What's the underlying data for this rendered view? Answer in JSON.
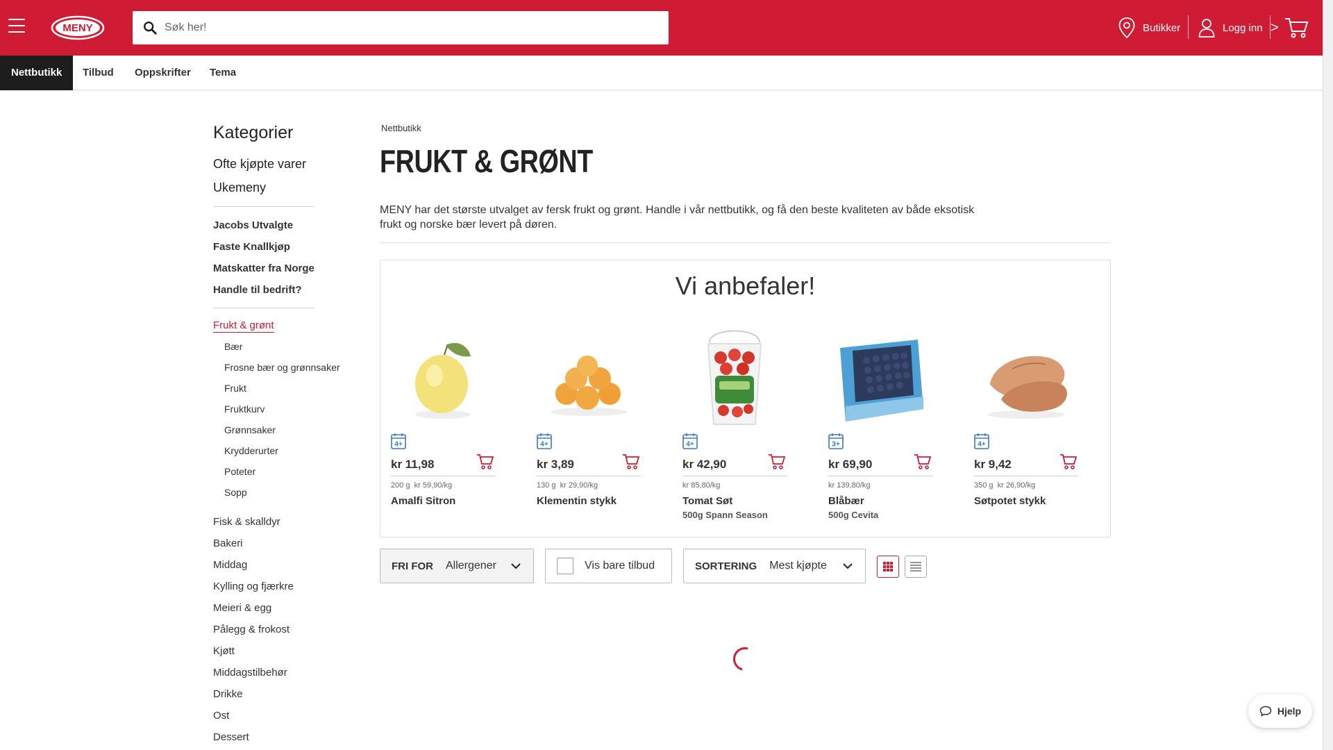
{
  "header": {
    "logo_text": "MENY",
    "search_placeholder": "Søk her!",
    "stores_label": "Butikker",
    "login_label": "Logg inn",
    "cart_arrow": ">"
  },
  "nav": {
    "tabs": [
      "Nettbutikk",
      "Tilbud",
      "Oppskrifter",
      "Tema"
    ],
    "active": "Nettbutikk"
  },
  "sidebar": {
    "title": "Kategorier",
    "top_links": [
      "Ofte kjøpte varer",
      "Ukemeny"
    ],
    "bold_links": [
      "Jacobs Utvalgte",
      "Faste Knallkjøp",
      "Matskatter fra Norge",
      "Handle til bedrift?"
    ],
    "active_category": "Frukt & grønt",
    "subcategories": [
      "Bær",
      "Frosne bær og grønnsaker",
      "Frukt",
      "Fruktkurv",
      "Grønnsaker",
      "Krydderurter",
      "Poteter",
      "Sopp"
    ],
    "categories": [
      "Fisk & skalldyr",
      "Bakeri",
      "Middag",
      "Kylling og fjærkre",
      "Meieri & egg",
      "Pålegg & frokost",
      "Kjøtt",
      "Middagstilbehør",
      "Drikke",
      "Ost",
      "Dessert"
    ]
  },
  "main": {
    "breadcrumb": "Nettbutikk",
    "title": "FRUKT & GRØNT",
    "intro": "MENY har det største utvalget av fersk frukt og grønt. Handle i vår nettbutikk, og få den beste kvaliteten av både eksotisk frukt og norske bær levert på døren."
  },
  "recommendations": {
    "title": "Vi anbefaler!",
    "products": [
      {
        "badge": "4+",
        "price": "kr 11,98",
        "weight": "200 g",
        "unit_price": "kr 59,90/kg",
        "name": "Amalfi Sitron",
        "sub": ""
      },
      {
        "badge": "4+",
        "price": "kr 3,89",
        "weight": "130 g",
        "unit_price": "kr 29,90/kg",
        "name": "Klementin stykk",
        "sub": ""
      },
      {
        "badge": "4+",
        "price": "kr 42,90",
        "weight": "",
        "unit_price": "kr 85,80/kg",
        "name": "Tomat Søt",
        "sub": "500g Spann Season"
      },
      {
        "badge": "3+",
        "price": "kr 69,90",
        "weight": "",
        "unit_price": "kr 139,80/kg",
        "name": "Blåbær",
        "sub": "500g Cevita"
      },
      {
        "badge": "4+",
        "price": "kr 9,42",
        "weight": "350 g",
        "unit_price": "kr 26,90/kg",
        "name": "Søtpotet stykk",
        "sub": ""
      }
    ]
  },
  "filters": {
    "frifor_label": "FRI FOR",
    "frifor_value": "Allergener",
    "offers_label": "Vis bare tilbud",
    "sort_label": "SORTERING",
    "sort_value": "Mest kjøpte"
  },
  "help_label": "Hjelp",
  "colors": {
    "brand": "#cf1b33",
    "badge": "#3a78c9"
  }
}
